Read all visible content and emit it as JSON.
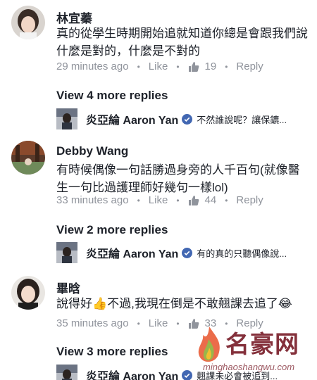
{
  "comments": [
    {
      "name": "林宜蓁",
      "text": "真的從學生時期開始追就知道你總是會跟我們說什麼是對的，什麼是不對的",
      "time": "29 minutes ago",
      "like_label": "Like",
      "likes": "19",
      "reply_label": "Reply",
      "more_replies": "View 4 more replies",
      "reply": {
        "name": "炎亞綸 Aaron Yan",
        "text": "不然誰說呢？讓保鑣..."
      }
    },
    {
      "name": "Debby Wang",
      "text": "有時候偶像一句話勝過身旁的人千百句(就像醫生一句比過護理師好幾句一樣lol)",
      "time": "33 minutes ago",
      "like_label": "Like",
      "likes": "44",
      "reply_label": "Reply",
      "more_replies": "View 2 more replies",
      "reply": {
        "name": "炎亞綸 Aaron Yan",
        "text": "有的真的只聽偶像說..."
      }
    },
    {
      "name": "畢晗",
      "text": "說得好👍不過,我現在倒是不敢翹課去追了😂",
      "time": "35 minutes ago",
      "like_label": "Like",
      "likes": "33",
      "reply_label": "Reply",
      "more_replies": "View 3 more replies",
      "reply": {
        "name": "炎亞綸 Aaron Yan",
        "text": "翹課未必會被追到..."
      }
    }
  ],
  "watermark": {
    "title": "名豪网",
    "url": "minghaoshangwu.com"
  },
  "colors": {
    "meta": "#90949c",
    "verified": "#4267b2",
    "like_icon": "#90949c",
    "watermark": "#7a1f2b"
  },
  "icons": {
    "like": "thumbs-up-icon",
    "verified": "verified-badge-icon"
  }
}
